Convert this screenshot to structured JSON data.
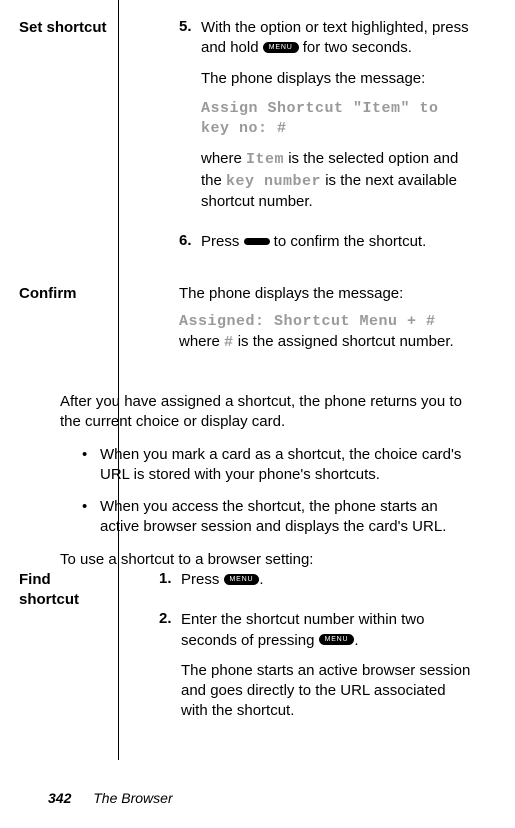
{
  "set_shortcut": {
    "label": "Set shortcut",
    "step5_num": "5.",
    "step5_a": "With the option or text highlighted, press and hold ",
    "step5_b": " for two seconds.",
    "step5_msg_intro": "The phone displays the message:",
    "step5_code": "Assign Shortcut \"Item\" to key no: #",
    "step5_where_a": "where ",
    "step5_where_item": "Item",
    "step5_where_b": " is the selected option and the ",
    "step5_where_key": "key number",
    "step5_where_c": " is the next available shortcut number.",
    "step6_num": "6.",
    "step6_a": "Press ",
    "step6_b": " to confirm the shortcut."
  },
  "confirm": {
    "label": "Confirm",
    "msg_intro": "The phone displays the message:",
    "code": "Assigned: Shortcut Menu + #",
    "where_a": "where ",
    "where_hash": "#",
    "where_b": " is the assigned shortcut number."
  },
  "after": {
    "p1": "After you have assigned a shortcut, the phone returns you to the current choice or display card.",
    "b1": "When you mark a card as a shortcut, the choice card's URL is stored with your phone's shortcuts.",
    "b2": "When you access the shortcut, the phone starts an active browser session and displays the card's URL.",
    "p2": "To use a shortcut to a browser setting:"
  },
  "find": {
    "label": "Find shortcut",
    "step1_num": "1.",
    "step1_a": "Press ",
    "step1_b": ".",
    "step2_num": "2.",
    "step2_a": "Enter the shortcut number within two seconds of pressing ",
    "step2_b": ".",
    "step2_result": "The phone starts an active browser session and goes directly to the URL associated with the shortcut."
  },
  "menu_key_label": "MENU",
  "footer": {
    "page": "342",
    "chapter": "The Browser"
  }
}
